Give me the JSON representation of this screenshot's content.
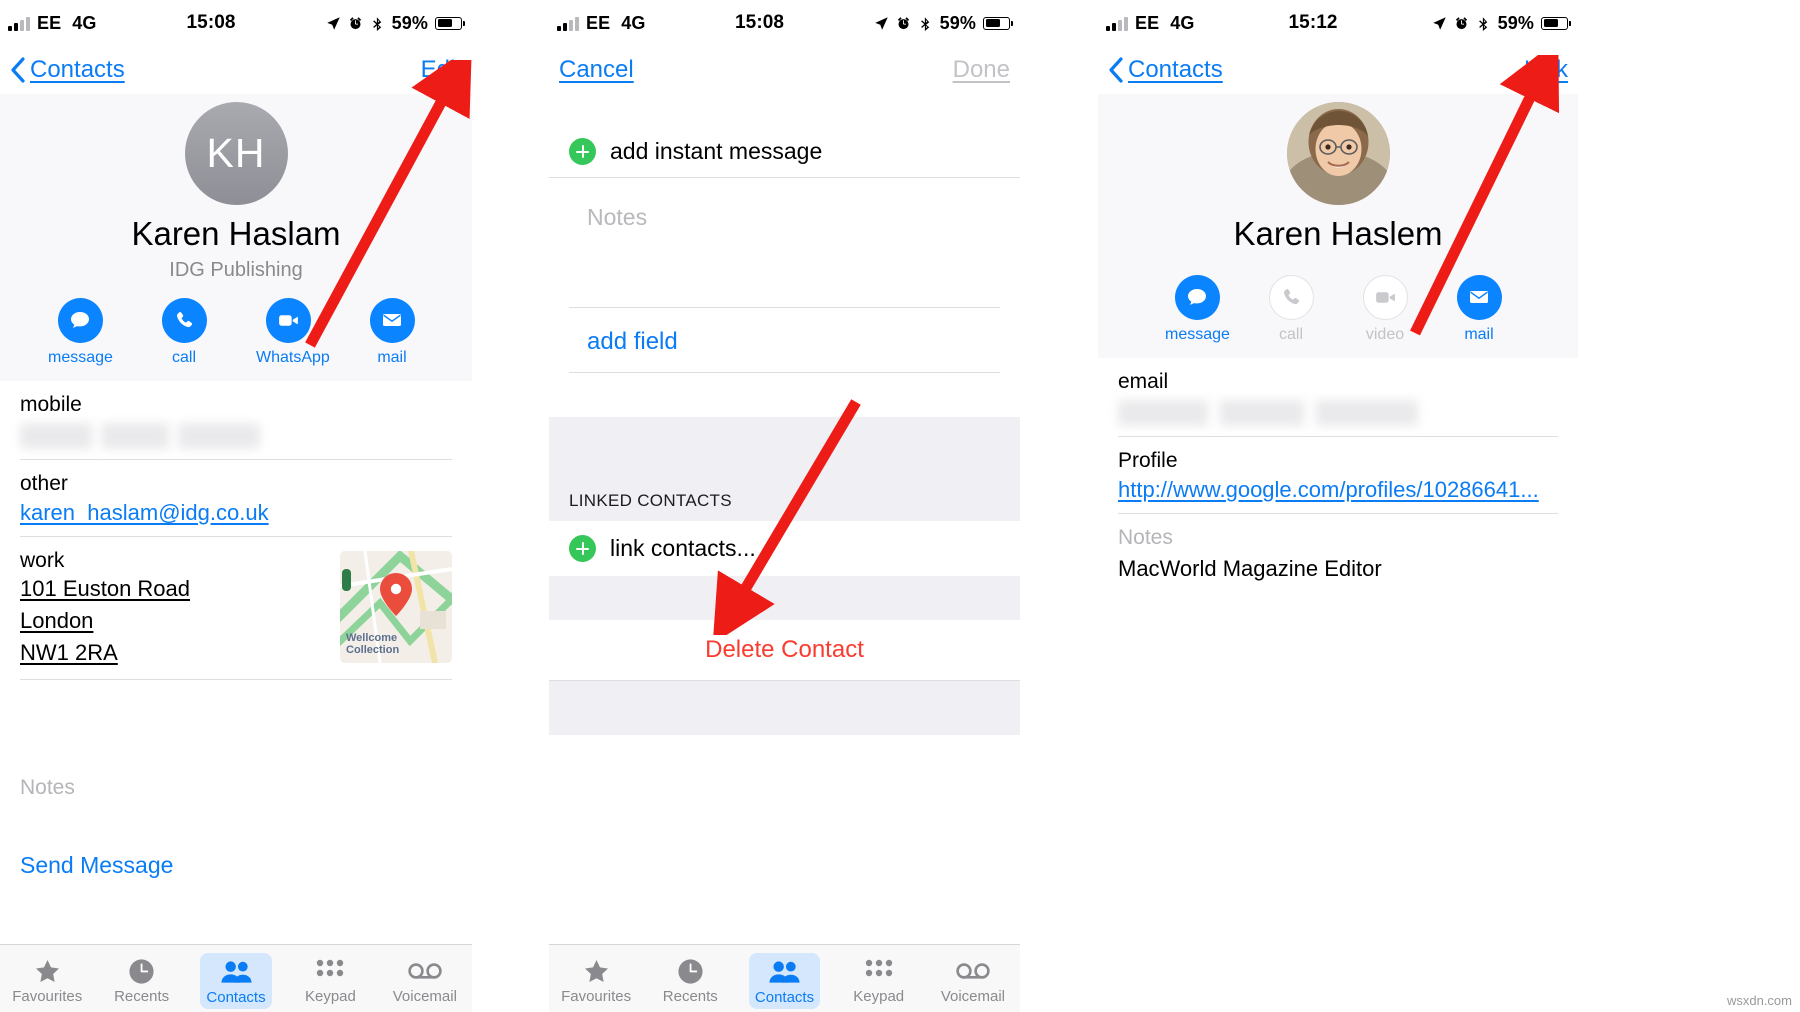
{
  "panel1": {
    "status": {
      "carrier": "EE",
      "network": "4G",
      "time": "15:08",
      "battery_pct": "59%"
    },
    "nav": {
      "back_label": "Contacts",
      "action_label": "Edit"
    },
    "contact": {
      "initials": "KH",
      "name": "Karen Haslam",
      "organisation": "IDG Publishing"
    },
    "actions": [
      {
        "label": "message",
        "icon": "message-bubble-icon",
        "enabled": true
      },
      {
        "label": "call",
        "icon": "phone-icon",
        "enabled": true
      },
      {
        "label": "WhatsApp",
        "icon": "video-camera-icon",
        "enabled": true
      },
      {
        "label": "mail",
        "icon": "envelope-icon",
        "enabled": true
      }
    ],
    "fields": [
      {
        "label": "mobile",
        "value": "",
        "redacted": true
      },
      {
        "label": "other",
        "value": "karen_haslam@idg.co.uk",
        "link": true
      },
      {
        "label": "work",
        "address": [
          "101 Euston Road",
          "London",
          "NW1 2RA"
        ],
        "map_caption": "Wellcome\nCollection"
      },
      {
        "label": "Notes",
        "value": "",
        "muted": true
      }
    ],
    "send_message_label": "Send Message",
    "tabs": [
      {
        "label": "Favourites",
        "icon": "star-icon",
        "active": false
      },
      {
        "label": "Recents",
        "icon": "clock-icon",
        "active": false
      },
      {
        "label": "Contacts",
        "icon": "people-icon",
        "active": true
      },
      {
        "label": "Keypad",
        "icon": "keypad-dots-icon",
        "active": false
      },
      {
        "label": "Voicemail",
        "icon": "voicemail-icon",
        "active": false
      }
    ]
  },
  "panel2": {
    "status": {
      "carrier": "EE",
      "network": "4G",
      "time": "15:08",
      "battery_pct": "59%"
    },
    "nav": {
      "cancel_label": "Cancel",
      "done_label": "Done",
      "done_disabled": true
    },
    "add_instant_message_label": "add instant message",
    "notes_placeholder": "Notes",
    "add_field_label": "add field",
    "linked_section_title": "LINKED CONTACTS",
    "link_contacts_label": "link contacts...",
    "delete_contact_label": "Delete Contact",
    "tabs": [
      {
        "label": "Favourites",
        "icon": "star-icon",
        "active": false
      },
      {
        "label": "Recents",
        "icon": "clock-icon",
        "active": false
      },
      {
        "label": "Contacts",
        "icon": "people-icon",
        "active": true
      },
      {
        "label": "Keypad",
        "icon": "keypad-dots-icon",
        "active": false
      },
      {
        "label": "Voicemail",
        "icon": "voicemail-icon",
        "active": false
      }
    ]
  },
  "panel3": {
    "status": {
      "carrier": "EE",
      "network": "4G",
      "time": "15:12",
      "battery_pct": "59%"
    },
    "nav": {
      "back_label": "Contacts",
      "action_label": "Link"
    },
    "contact": {
      "name": "Karen Haslem",
      "avatar": "photo-portrait"
    },
    "actions": [
      {
        "label": "message",
        "icon": "message-bubble-icon",
        "enabled": true
      },
      {
        "label": "call",
        "icon": "phone-icon",
        "enabled": false
      },
      {
        "label": "video",
        "icon": "video-camera-icon",
        "enabled": false
      },
      {
        "label": "mail",
        "icon": "envelope-icon",
        "enabled": true
      }
    ],
    "fields": [
      {
        "label": "email",
        "value": "",
        "redacted": true
      },
      {
        "label": "Profile",
        "value": "http://www.google.com/profiles/10286641...",
        "link": true
      },
      {
        "label": "Notes",
        "value": "MacWorld Magazine Editor",
        "muted_label": true
      }
    ]
  },
  "annotations": {
    "arrow_color": "#ee1c16",
    "arrows": [
      {
        "name": "arrow-to-edit-button",
        "target": "panel1.nav.action_label"
      },
      {
        "name": "arrow-to-link-contacts",
        "target": "panel2.link_contacts_label"
      },
      {
        "name": "arrow-to-link-button",
        "target": "panel3.nav.action_label"
      }
    ]
  },
  "watermark": "wsxdn.com"
}
